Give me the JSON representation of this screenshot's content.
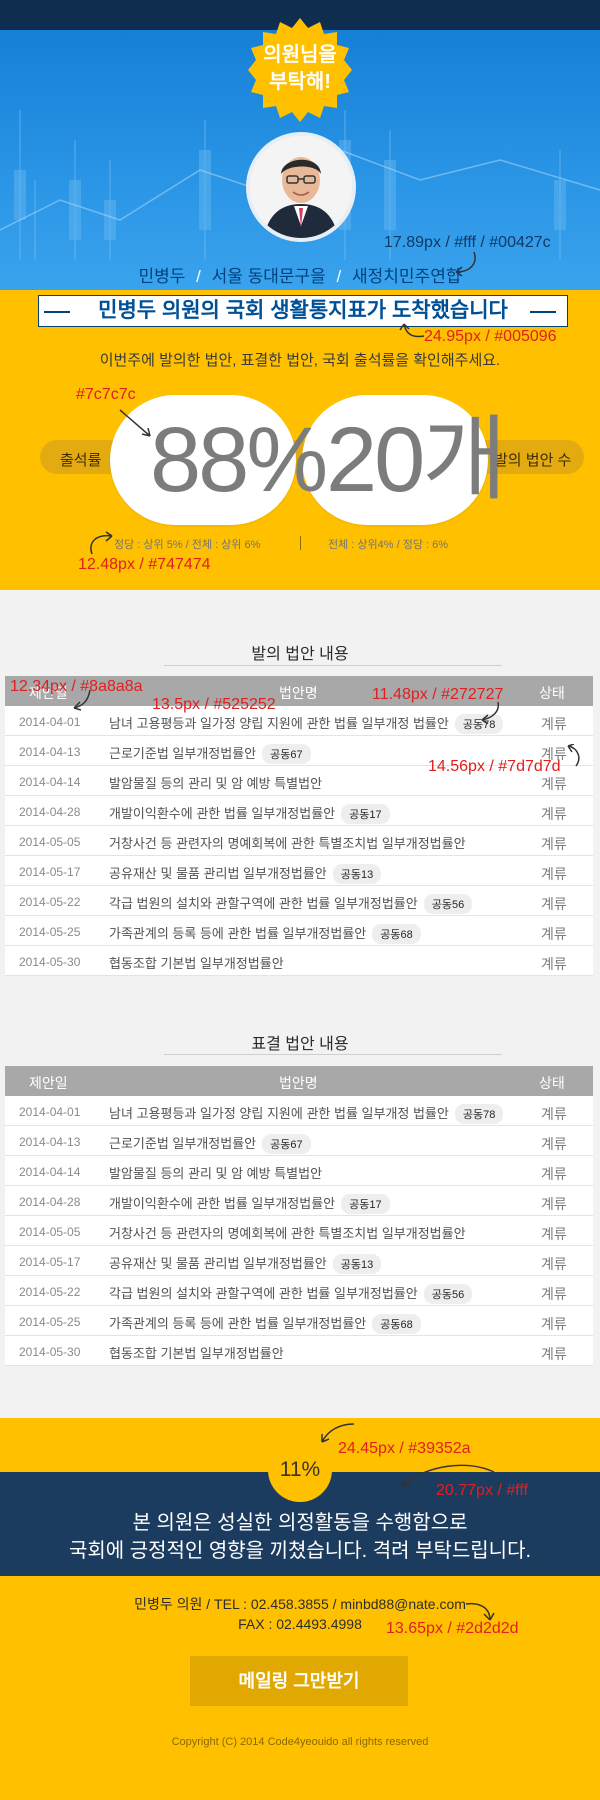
{
  "colors": {
    "navy": "#00427c",
    "headline_blue": "#005096",
    "yellow": "#ffc000",
    "stat_gray": "#7c7c7c",
    "note_gray": "#747474",
    "date_gray": "#8a8a8a",
    "bill_text": "#525252",
    "tag_text": "#272727",
    "status_gray": "#7d7d7d",
    "circle_text": "#39352a",
    "contact_text": "#2d2d2d",
    "annotation_red": "#e0201e"
  },
  "header": {
    "badge": "의원님을\n부탁해!",
    "badge_line1": "의원님을",
    "badge_line2": "부탁해!",
    "avatar_icon": "person-photo",
    "member_name": "민병두",
    "member_district": "서울 동대문구을",
    "member_party": "새정치민주연합",
    "separator": "/",
    "headline": "민병두 의원의 국회 생활통지표가 도착했습니다",
    "subline": "이번주에 발의한 법안, 표결한 법안, 국회 출석률을 확인해주세요."
  },
  "stats": {
    "attendance_label": "출석률",
    "attendance_value": "88%",
    "bills_label": "발의 법안 수",
    "bills_value": "20개",
    "attendance_note": "정당 : 상위 5% / 전체 : 상위 6%",
    "bills_note": "전체 : 상위4% / 정당 : 6%"
  },
  "annotations": {
    "member_line": "17.89px / #fff / #00427c",
    "headline": "24.95px / #005096",
    "stat_color": "#7c7c7c",
    "stat_note": "12.48px / #747474",
    "date": "12.34px / #8a8a8a",
    "bill": "13.5px / #525252",
    "tag": "11.48px / #272727",
    "status": "14.56px / #7d7d7d",
    "circle": "24.45px / #39352a",
    "navy_text": "20.77px / #fff",
    "contact": "13.65px / #2d2d2d"
  },
  "proposed": {
    "title": "발의 법안 내용",
    "headers": {
      "date": "제안일",
      "bill": "법안명",
      "status": "상태"
    },
    "rows": [
      {
        "date": "2014-04-01",
        "bill": "남녀 고용평등과 일가정 양립 지원에 관한 법률 일부개정 법률안",
        "tag": "공동78",
        "status": "계류"
      },
      {
        "date": "2014-04-13",
        "bill": "근로기준법 일부개정법률안",
        "tag": "공동67",
        "status": "계류"
      },
      {
        "date": "2014-04-14",
        "bill": "발암물질 등의 관리 및 암 예방 특별법안",
        "tag": "",
        "status": "계류"
      },
      {
        "date": "2014-04-28",
        "bill": "개발이익환수에 관한 법률 일부개정법률안",
        "tag": "공동17",
        "status": "계류"
      },
      {
        "date": "2014-05-05",
        "bill": "거창사건 등 관련자의 명예회복에 관한 특별조치법 일부개정법률안",
        "tag": "",
        "status": "계류"
      },
      {
        "date": "2014-05-17",
        "bill": "공유재산 및 물품 관리법 일부개정법률안",
        "tag": "공동13",
        "status": "계류"
      },
      {
        "date": "2014-05-22",
        "bill": "각급 법원의 설치와 관할구역에 관한 법률 일부개정법률안",
        "tag": "공동56",
        "status": "계류"
      },
      {
        "date": "2014-05-25",
        "bill": "가족관계의 등록 등에 관한 법률 일부개정법률안",
        "tag": "공동68",
        "status": "계류"
      },
      {
        "date": "2014-05-30",
        "bill": "협동조합 기본법 일부개정법률안",
        "tag": "",
        "status": "계류"
      }
    ]
  },
  "voted": {
    "title": "표결 법안 내용",
    "headers": {
      "date": "제안일",
      "bill": "법안명",
      "status": "상태"
    },
    "rows": [
      {
        "date": "2014-04-01",
        "bill": "남녀 고용평등과 일가정 양립 지원에 관한 법률 일부개정 법률안",
        "tag": "공동78",
        "status": "계류"
      },
      {
        "date": "2014-04-13",
        "bill": "근로기준법 일부개정법률안",
        "tag": "공동67",
        "status": "계류"
      },
      {
        "date": "2014-04-14",
        "bill": "발암물질 등의 관리 및 암 예방 특별법안",
        "tag": "",
        "status": "계류"
      },
      {
        "date": "2014-04-28",
        "bill": "개발이익환수에 관한 법률 일부개정법률안",
        "tag": "공동17",
        "status": "계류"
      },
      {
        "date": "2014-05-05",
        "bill": "거창사건 등 관련자의 명예회복에 관한 특별조치법 일부개정법률안",
        "tag": "",
        "status": "계류"
      },
      {
        "date": "2014-05-17",
        "bill": "공유재산 및 물품 관리법 일부개정법률안",
        "tag": "공동13",
        "status": "계류"
      },
      {
        "date": "2014-05-22",
        "bill": "각급 법원의 설치와 관할구역에 관한 법률 일부개정법률안",
        "tag": "공동56",
        "status": "계류"
      },
      {
        "date": "2014-05-25",
        "bill": "가족관계의 등록 등에 관한 법률 일부개정법률안",
        "tag": "공동68",
        "status": "계류"
      },
      {
        "date": "2014-05-30",
        "bill": "협동조합 기본법 일부개정법률안",
        "tag": "",
        "status": "계류"
      }
    ]
  },
  "footer": {
    "percent": "11%",
    "line1": "본 의원은 성실한 의정활동을 수행함으로",
    "line2": "국회에 긍정적인 영향을 끼쳤습니다. 격려 부탁드립니다.",
    "contact_line1": "민병두 의원 /  TEL : 02.458.3855 / minbd88@nate.com",
    "contact_line2": "FAX : 02.4493.4998",
    "unsubscribe": "메일링 그만받기",
    "copyright": "Copyright (C) 2014 Code4yeouido all rights reserved"
  }
}
